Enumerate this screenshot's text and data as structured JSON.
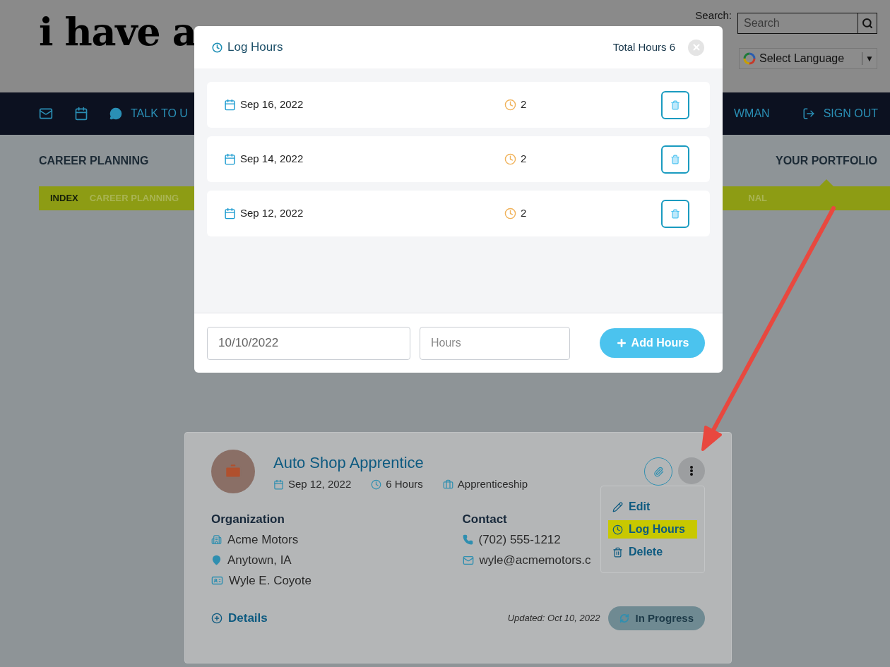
{
  "header": {
    "logo": "i have a",
    "search_label": "Search:",
    "search": {
      "placeholder": "Search"
    },
    "language": "Select Language",
    "language_caret": "▼"
  },
  "nav": {
    "talk": "TALK TO U",
    "cut_item": "WMAN",
    "sign_out": "SIGN OUT"
  },
  "section_tabs": [
    {
      "label": "CAREER PLANNING",
      "selected": false
    },
    {
      "label": "YOUR PORTFOLIO",
      "selected": true
    }
  ],
  "breadcrumb": [
    {
      "label": "INDEX",
      "selected": true
    },
    {
      "label": "CAREER PLANNING",
      "selected": false
    }
  ],
  "breadcrumb_cut": "NAL",
  "card": {
    "title": "Auto Shop Apprentice",
    "date": "Sep 12, 2022",
    "hours": "6 Hours",
    "type": "Apprenticeship",
    "organization": {
      "heading": "Organization",
      "name": "Acme Motors",
      "location": "Anytown, IA",
      "person": "Wyle E. Coyote"
    },
    "contact": {
      "heading": "Contact",
      "phone": "(702) 555-1212",
      "email": "wyle@acmemotors.c"
    },
    "details": "Details",
    "updated": "Updated: Oct 10, 2022",
    "status": "In Progress"
  },
  "menu": [
    {
      "kind": "edit",
      "label": "Edit",
      "selected": false
    },
    {
      "kind": "log",
      "label": "Log Hours",
      "selected": true
    },
    {
      "kind": "delete",
      "label": "Delete",
      "selected": false
    }
  ],
  "modal": {
    "title": "Log Hours",
    "total": "Total Hours 6",
    "entries": [
      {
        "date": "Sep 16, 2022",
        "hours": "2"
      },
      {
        "date": "Sep 14, 2022",
        "hours": "2"
      },
      {
        "date": "Sep 12, 2022",
        "hours": "2"
      }
    ],
    "date_input": {
      "value": "10/10/2022"
    },
    "hours_input": {
      "placeholder": "Hours"
    },
    "add_button": "Add Hours"
  }
}
